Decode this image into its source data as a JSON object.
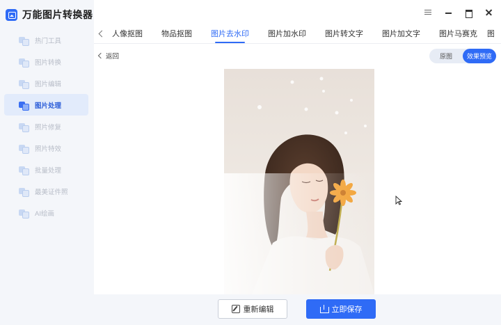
{
  "app": {
    "title": "万能图片转换器",
    "brand_color": "#2f6bf6"
  },
  "sidebar": {
    "items": [
      {
        "label": "热门工具",
        "icon": "hot-tools-icon",
        "active": false
      },
      {
        "label": "图片转换",
        "icon": "image-convert-icon",
        "active": false
      },
      {
        "label": "图片编辑",
        "icon": "image-edit-icon",
        "active": false
      },
      {
        "label": "图片处理",
        "icon": "image-process-icon",
        "active": true
      },
      {
        "label": "照片修复",
        "icon": "photo-repair-icon",
        "active": false
      },
      {
        "label": "照片特效",
        "icon": "photo-effects-icon",
        "active": false
      },
      {
        "label": "批量处理",
        "icon": "batch-process-icon",
        "active": false
      },
      {
        "label": "最美证件照",
        "icon": "id-photo-icon",
        "active": false
      },
      {
        "label": "AI绘画",
        "icon": "ai-painting-icon",
        "active": false
      }
    ]
  },
  "window_controls": [
    "menu-icon",
    "minimize-icon",
    "maximize-icon",
    "close-icon"
  ],
  "tabs": {
    "items": [
      {
        "label": "人像抠图",
        "active": false
      },
      {
        "label": "物品抠图",
        "active": false
      },
      {
        "label": "图片去水印",
        "active": true
      },
      {
        "label": "图片加水印",
        "active": false
      },
      {
        "label": "图片转文字",
        "active": false
      },
      {
        "label": "图片加文字",
        "active": false
      },
      {
        "label": "图片马赛克",
        "active": false
      }
    ],
    "clipped_next": "图"
  },
  "toolbar": {
    "back_label": "返回",
    "view_original": "原图",
    "view_preview": "效果预览",
    "active_view": "效果预览"
  },
  "image": {
    "subject": "young woman with eyes closed smelling an orange flower"
  },
  "actions": {
    "reedit_label": "重新编辑",
    "save_label": "立即保存"
  }
}
